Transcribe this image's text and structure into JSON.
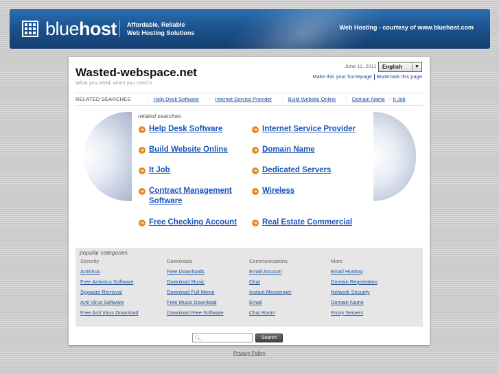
{
  "header": {
    "logo_part_a": "blue",
    "logo_part_b": "host",
    "tagline_line1": "Affordable, Reliable",
    "tagline_line2": "Web Hosting Solutions",
    "courtesy": "Web Hosting - courtesy of www.bluehost.com"
  },
  "site": {
    "title": "Wasted-webspace.net",
    "subtitle": "What you need, when you need it",
    "date": "June 11, 2011",
    "language": "English",
    "homepage_link": "Make this your homepage",
    "bookmark_link": "Bookmark this page"
  },
  "related_bar": {
    "label": "RELATED SEARCHES",
    "links": [
      "Help Desk Software",
      "Internet Service Provider",
      "Build Website Online",
      "Domain Name",
      "It Job"
    ]
  },
  "related_searches": {
    "label": "related searches",
    "items": [
      [
        "Help Desk Software"
      ],
      [
        "Internet Service Provider"
      ],
      [
        "Build Website Online"
      ],
      [
        "Domain Name"
      ],
      [
        "It Job"
      ],
      [
        "Dedicated Servers"
      ],
      [
        "Contract Management",
        "Software"
      ],
      [
        "Wireless"
      ],
      [
        "Free Checking Account"
      ],
      [
        "Real Estate Commercial"
      ]
    ]
  },
  "popular": {
    "title": "popular categories",
    "columns": [
      {
        "heading": "Security",
        "links": [
          "Antivirus",
          "Free Antivirus Software",
          "Spyware Removal",
          "Anti Virus Software",
          "Free Anti Virus Download"
        ]
      },
      {
        "heading": "Downloads",
        "links": [
          "Free Downloads",
          "Download Music",
          "Download Full Movie",
          "Free Music Download",
          "Download Free Software"
        ]
      },
      {
        "heading": "Communications",
        "links": [
          "Email Account",
          "Chat",
          "Instant Messenger",
          "Email",
          "Chat Room"
        ]
      },
      {
        "heading": "More",
        "links": [
          "Email Hosting",
          "Domain Registration",
          "Network Security",
          "Domain Name",
          "Proxy Servers"
        ]
      }
    ]
  },
  "search": {
    "value": "",
    "button_label": "Search"
  },
  "footer": {
    "privacy": "Privacy Policy"
  },
  "icons": {
    "search": "magnifier-icon",
    "arrow_bullet": "arrow-right-circle-icon",
    "dropdown": "triangle-down-icon"
  },
  "colors": {
    "header_blue": "#1a4f8a",
    "link_blue": "#1a55b8",
    "bullet_orange": "#e8891a"
  }
}
